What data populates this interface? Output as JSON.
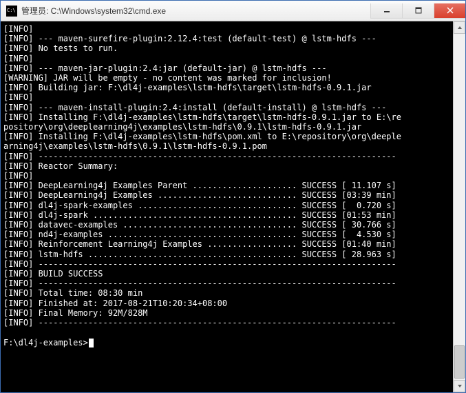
{
  "window": {
    "title": "管理员: C:\\Windows\\system32\\cmd.exe"
  },
  "lines": {
    "l0": "[INFO]",
    "l1": "[INFO] --- maven-surefire-plugin:2.12.4:test (default-test) @ lstm-hdfs ---",
    "l2": "[INFO] No tests to run.",
    "l3": "[INFO]",
    "l4": "[INFO] --- maven-jar-plugin:2.4:jar (default-jar) @ lstm-hdfs ---",
    "l5": "[WARNING] JAR will be empty - no content was marked for inclusion!",
    "l6": "[INFO] Building jar: F:\\dl4j-examples\\lstm-hdfs\\target\\lstm-hdfs-0.9.1.jar",
    "l7": "[INFO]",
    "l8": "[INFO] --- maven-install-plugin:2.4:install (default-install) @ lstm-hdfs ---",
    "l9": "[INFO] Installing F:\\dl4j-examples\\lstm-hdfs\\target\\lstm-hdfs-0.9.1.jar to E:\\re",
    "l10": "pository\\org\\deeplearning4j\\examples\\lstm-hdfs\\0.9.1\\lstm-hdfs-0.9.1.jar",
    "l11": "[INFO] Installing F:\\dl4j-examples\\lstm-hdfs\\pom.xml to E:\\repository\\org\\deeple",
    "l12": "arning4j\\examples\\lstm-hdfs\\0.9.1\\lstm-hdfs-0.9.1.pom",
    "l13": "[INFO] ------------------------------------------------------------------------",
    "l14": "[INFO] Reactor Summary:",
    "l15": "[INFO]",
    "l16": "[INFO] DeepLearning4j Examples Parent ..................... SUCCESS [ 11.107 s]",
    "l17": "[INFO] DeepLearning4j Examples ............................ SUCCESS [03:39 min]",
    "l18": "[INFO] dl4j-spark-examples ................................ SUCCESS [  0.720 s]",
    "l19": "[INFO] dl4j-spark ......................................... SUCCESS [01:53 min]",
    "l20": "[INFO] datavec-examples ................................... SUCCESS [ 30.766 s]",
    "l21": "[INFO] nd4j-examples ...................................... SUCCESS [  4.530 s]",
    "l22": "[INFO] Reinforcement Learning4j Examples .................. SUCCESS [01:40 min]",
    "l23": "[INFO] lstm-hdfs .......................................... SUCCESS [ 28.963 s]",
    "l24": "[INFO] ------------------------------------------------------------------------",
    "l25": "[INFO] BUILD SUCCESS",
    "l26": "[INFO] ------------------------------------------------------------------------",
    "l27": "[INFO] Total time: 08:30 min",
    "l28": "[INFO] Finished at: 2017-08-21T10:20:34+08:00",
    "l29": "[INFO] Final Memory: 92M/828M",
    "l30": "[INFO] ------------------------------------------------------------------------",
    "l31": "",
    "l32": "F:\\dl4j-examples>"
  }
}
